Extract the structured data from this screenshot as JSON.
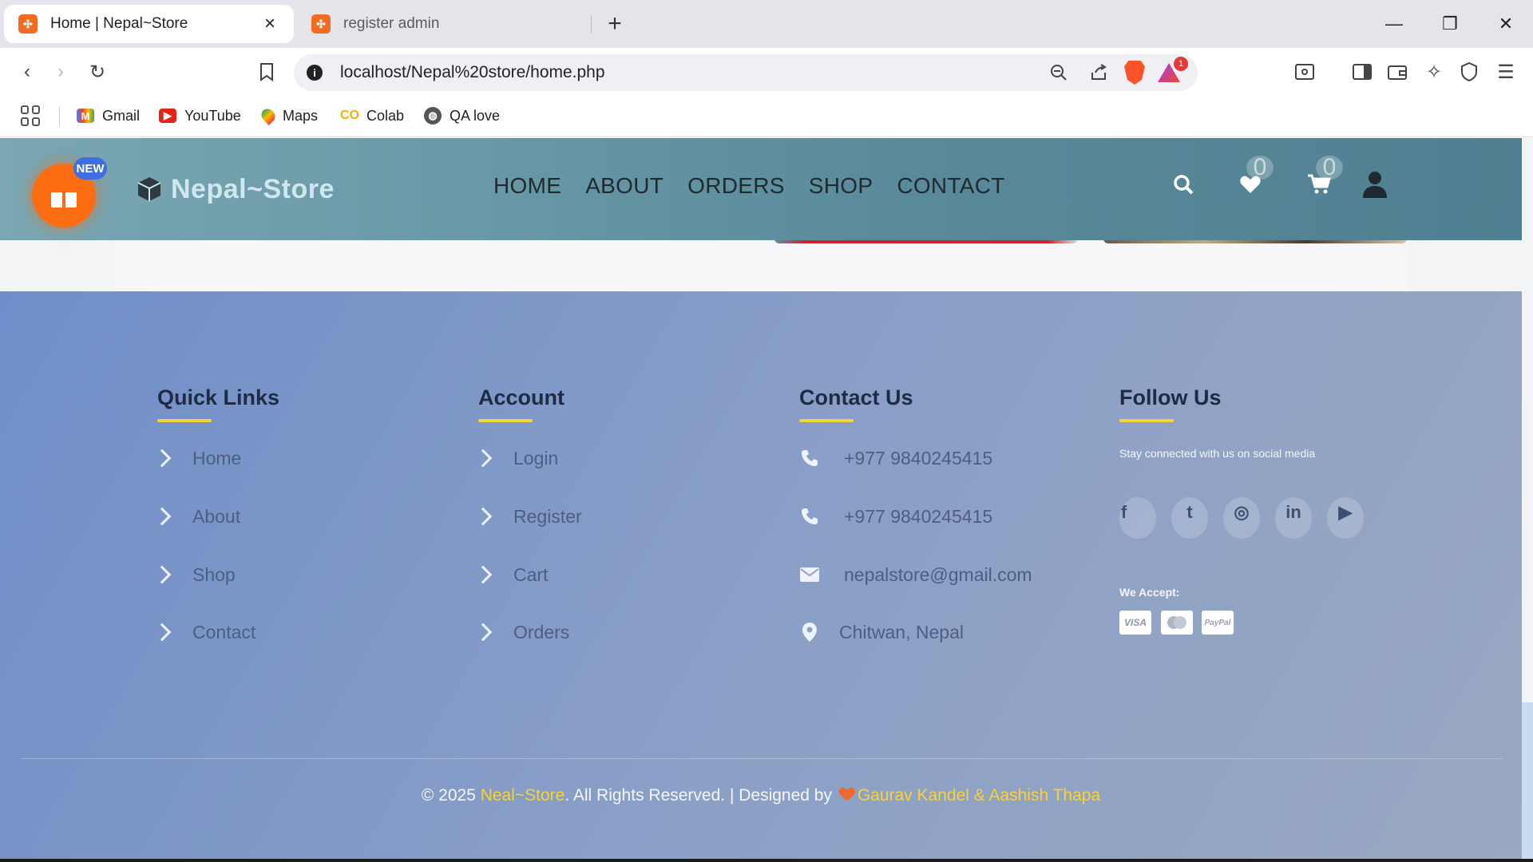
{
  "browser": {
    "tabs": [
      {
        "title": "Home | Nepal~Store",
        "active": true
      },
      {
        "title": "register admin",
        "active": false
      }
    ],
    "url": "localhost/Nepal%20store/home.php",
    "extension_badge": "1",
    "bookmarks": [
      {
        "label": "Gmail",
        "icon": "gmail-icon"
      },
      {
        "label": "YouTube",
        "icon": "youtube-icon"
      },
      {
        "label": "Maps",
        "icon": "maps-icon"
      },
      {
        "label": "Colab",
        "icon": "colab-icon"
      },
      {
        "label": "QA love",
        "icon": "globe-icon"
      }
    ]
  },
  "site": {
    "new_badge": "NEW",
    "brand": "Nepal~Store",
    "menu": [
      "HOME",
      "ABOUT",
      "ORDERS",
      "SHOP",
      "CONTACT"
    ],
    "wishlist_count": "0",
    "cart_count": "0"
  },
  "footer": {
    "quick_links": {
      "title": "Quick Links",
      "items": [
        "Home",
        "About",
        "Shop",
        "Contact"
      ]
    },
    "account": {
      "title": "Account",
      "items": [
        "Login",
        "Register",
        "Cart",
        "Orders"
      ]
    },
    "contact": {
      "title": "Contact Us",
      "items": [
        {
          "icon": "phone-icon",
          "text": "+977 9840245415"
        },
        {
          "icon": "phone-icon",
          "text": "+977 9840245415"
        },
        {
          "icon": "envelope-icon",
          "text": "nepalstore@gmail.com"
        },
        {
          "icon": "map-marker-icon",
          "text": "Chitwan, Nepal"
        }
      ]
    },
    "follow": {
      "title": "Follow Us",
      "subtitle": "Stay connected with us on social media",
      "socials": [
        "facebook-icon",
        "twitter-icon",
        "instagram-icon",
        "linkedin-icon",
        "youtube-icon"
      ],
      "social_glyphs": [
        "f",
        "t",
        "◎",
        "in",
        "▶"
      ],
      "we_accept": "We Accept:",
      "payments": [
        "VISA",
        "MC",
        "PayPal"
      ]
    },
    "copyright": {
      "prefix": "© 2025 ",
      "brand": "Neal~Store",
      "middle": ". All Rights Reserved. | Designed by ",
      "designers": "Gaurav Kandel & Aashish Thapa"
    }
  },
  "colors": {
    "accent_yellow": "#f7d33a",
    "gift_orange": "#fb6d13",
    "nav_gradient": "#5a8a9a"
  }
}
